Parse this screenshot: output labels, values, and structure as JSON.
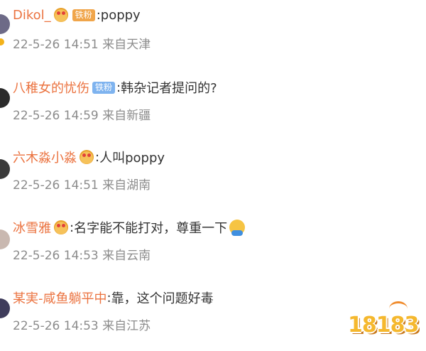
{
  "comments": [
    {
      "username": "Dikol_",
      "badge": "铁粉",
      "text": "poppy",
      "meta": "22-5-26 14:51  来自天津"
    },
    {
      "username": "八稚女的忧伤",
      "badge": "铁粉",
      "text": "韩杂记者提问的?",
      "meta": "22-5-26 14:59  来自新疆"
    },
    {
      "username": "六木淼小淼",
      "text": "人叫poppy",
      "meta": "22-5-26 14:51  来自湖南"
    },
    {
      "username": "冰雪雅",
      "text": "名字能不能打对，尊重一下",
      "meta": "22-5-26 14:53  来自云南"
    },
    {
      "username": "某実-咸鱼躺平中",
      "text": "靠，这个问题好毒",
      "meta": "22-5-26 14:53  来自江苏"
    }
  ],
  "colon": ":",
  "watermark": "18183",
  "colors": {
    "username": "#eb7340",
    "meta": "#8c8c8c",
    "badge_blue": "#7eb3ef",
    "badge_orange": "#f0a54a"
  }
}
